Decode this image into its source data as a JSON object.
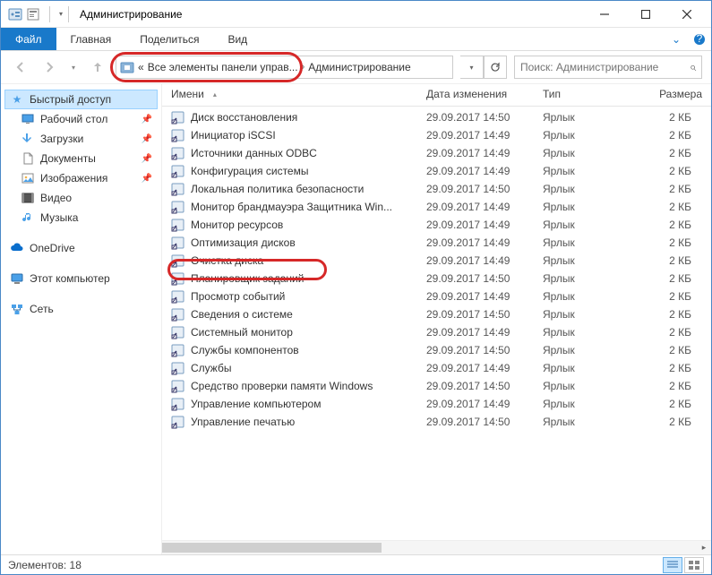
{
  "title": "Администрирование",
  "ribbon": {
    "file": "Файл",
    "tabs": [
      "Главная",
      "Поделиться",
      "Вид"
    ]
  },
  "address": {
    "parts": [
      "«",
      "Все элементы панели управ...",
      "Администрирование"
    ],
    "search_placeholder": "Поиск: Администрирование"
  },
  "sidebar": {
    "quick_access": "Быстрый доступ",
    "items": [
      {
        "label": "Рабочий стол",
        "pinned": true,
        "icon": "desktop"
      },
      {
        "label": "Загрузки",
        "pinned": true,
        "icon": "downloads"
      },
      {
        "label": "Документы",
        "pinned": true,
        "icon": "documents"
      },
      {
        "label": "Изображения",
        "pinned": true,
        "icon": "pictures"
      },
      {
        "label": "Видео",
        "pinned": false,
        "icon": "video"
      },
      {
        "label": "Музыка",
        "pinned": false,
        "icon": "music"
      }
    ],
    "onedrive": "OneDrive",
    "thispc": "Этот компьютер",
    "network": "Сеть"
  },
  "columns": {
    "name": "Имени",
    "date": "Дата изменения",
    "type": "Тип",
    "size": "Размера"
  },
  "files": [
    {
      "name": "Диск восстановления",
      "date": "29.09.2017 14:50",
      "type": "Ярлык",
      "size": "2 КБ"
    },
    {
      "name": "Инициатор iSCSI",
      "date": "29.09.2017 14:49",
      "type": "Ярлык",
      "size": "2 КБ"
    },
    {
      "name": "Источники данных ODBC",
      "date": "29.09.2017 14:49",
      "type": "Ярлык",
      "size": "2 КБ"
    },
    {
      "name": "Конфигурация системы",
      "date": "29.09.2017 14:49",
      "type": "Ярлык",
      "size": "2 КБ"
    },
    {
      "name": "Локальная политика безопасности",
      "date": "29.09.2017 14:50",
      "type": "Ярлык",
      "size": "2 КБ"
    },
    {
      "name": "Монитор брандмауэра Защитника Win...",
      "date": "29.09.2017 14:49",
      "type": "Ярлык",
      "size": "2 КБ"
    },
    {
      "name": "Монитор ресурсов",
      "date": "29.09.2017 14:49",
      "type": "Ярлык",
      "size": "2 КБ"
    },
    {
      "name": "Оптимизация дисков",
      "date": "29.09.2017 14:49",
      "type": "Ярлык",
      "size": "2 КБ"
    },
    {
      "name": "Очистка диска",
      "date": "29.09.2017 14:49",
      "type": "Ярлык",
      "size": "2 КБ"
    },
    {
      "name": "Планировщик заданий",
      "date": "29.09.2017 14:50",
      "type": "Ярлык",
      "size": "2 КБ",
      "highlight": true
    },
    {
      "name": "Просмотр событий",
      "date": "29.09.2017 14:49",
      "type": "Ярлык",
      "size": "2 КБ"
    },
    {
      "name": "Сведения о системе",
      "date": "29.09.2017 14:50",
      "type": "Ярлык",
      "size": "2 КБ"
    },
    {
      "name": "Системный монитор",
      "date": "29.09.2017 14:49",
      "type": "Ярлык",
      "size": "2 КБ"
    },
    {
      "name": "Службы компонентов",
      "date": "29.09.2017 14:50",
      "type": "Ярлык",
      "size": "2 КБ"
    },
    {
      "name": "Службы",
      "date": "29.09.2017 14:49",
      "type": "Ярлык",
      "size": "2 КБ"
    },
    {
      "name": "Средство проверки памяти Windows",
      "date": "29.09.2017 14:50",
      "type": "Ярлык",
      "size": "2 КБ"
    },
    {
      "name": "Управление компьютером",
      "date": "29.09.2017 14:49",
      "type": "Ярлык",
      "size": "2 КБ"
    },
    {
      "name": "Управление печатью",
      "date": "29.09.2017 14:50",
      "type": "Ярлык",
      "size": "2 КБ"
    }
  ],
  "status": {
    "count_label": "Элементов: 18"
  },
  "colors": {
    "highlight": "#d62828",
    "accent": "#1979ca",
    "selection": "#cce8ff"
  }
}
